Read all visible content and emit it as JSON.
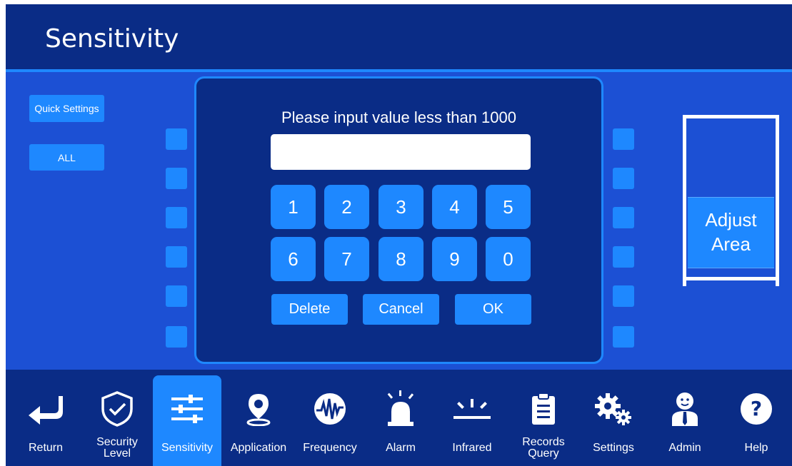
{
  "header": {
    "title": "Sensitivity"
  },
  "left_panel": {
    "quick_settings": "Quick Settings",
    "all": "ALL"
  },
  "dialog": {
    "prompt": "Please input value less than 1000",
    "input_value": "",
    "keys": [
      "1",
      "2",
      "3",
      "4",
      "5",
      "6",
      "7",
      "8",
      "9",
      "0"
    ],
    "delete": "Delete",
    "cancel": "Cancel",
    "ok": "OK"
  },
  "adjust_area": {
    "label_line1": "Adjust",
    "label_line2": "Area"
  },
  "nav": [
    {
      "label": "Return",
      "icon": "return-icon"
    },
    {
      "label": "Security\nLevel",
      "icon": "shield-check-icon"
    },
    {
      "label": "Sensitivity",
      "icon": "sliders-icon",
      "active": true
    },
    {
      "label": "Application",
      "icon": "location-pin-icon"
    },
    {
      "label": "Frequency",
      "icon": "waveform-icon"
    },
    {
      "label": "Alarm",
      "icon": "alarm-light-icon"
    },
    {
      "label": "Infrared",
      "icon": "infrared-icon"
    },
    {
      "label": "Records\nQuery",
      "icon": "clipboard-icon"
    },
    {
      "label": "Settings",
      "icon": "gears-icon"
    },
    {
      "label": "Admin",
      "icon": "admin-person-icon"
    },
    {
      "label": "Help",
      "icon": "help-icon"
    }
  ],
  "colors": {
    "dark_navy": "#0a2c86",
    "panel_blue": "#1c50d4",
    "accent_blue": "#1e88ff"
  }
}
